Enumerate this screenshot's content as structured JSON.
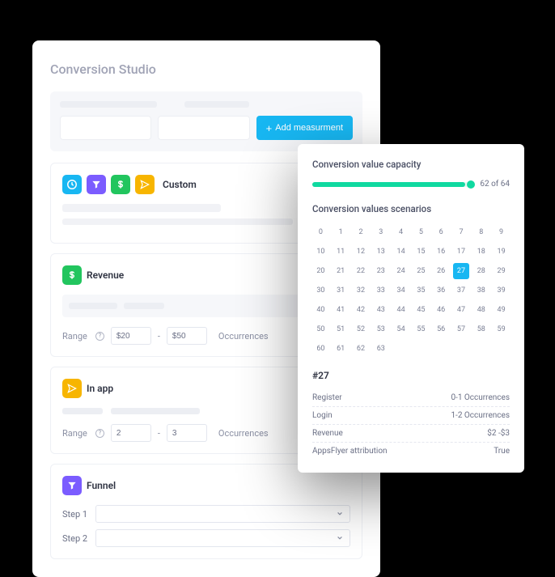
{
  "header": {
    "title": "Conversion Studio"
  },
  "toolbar": {
    "add_label": "Add measurment"
  },
  "sections": {
    "custom": {
      "label": "Custom"
    },
    "revenue": {
      "label": "Revenue",
      "range_label": "Range",
      "from": "$20",
      "to": "$50",
      "occurrences_label": "Occurrences"
    },
    "inapp": {
      "label": "In app",
      "range_label": "Range",
      "from": "2",
      "to": "3",
      "occurrences_label": "Occurrences"
    },
    "funnel": {
      "label": "Funnel",
      "step1_label": "Step 1",
      "step2_label": "Step 2"
    }
  },
  "side": {
    "capacity_title": "Conversion value capacity",
    "capacity_text": "62 of 64",
    "scenarios_title": "Conversion values scenarios",
    "cells": [
      "0",
      "1",
      "2",
      "3",
      "4",
      "5",
      "6",
      "7",
      "8",
      "9",
      "10",
      "11",
      "12",
      "13",
      "14",
      "15",
      "16",
      "17",
      "18",
      "19",
      "20",
      "21",
      "22",
      "23",
      "24",
      "25",
      "26",
      "27",
      "28",
      "29",
      "30",
      "31",
      "32",
      "33",
      "34",
      "35",
      "36",
      "37",
      "38",
      "39",
      "40",
      "41",
      "42",
      "43",
      "44",
      "45",
      "46",
      "47",
      "48",
      "49",
      "50",
      "51",
      "52",
      "53",
      "54",
      "55",
      "56",
      "57",
      "58",
      "59",
      "60",
      "61",
      "62",
      "63"
    ],
    "selected": "27",
    "detail_title": "#27",
    "details": [
      {
        "k": "Register",
        "v": "0-1 Occurrences"
      },
      {
        "k": "Login",
        "v": "1-2 Occurrences"
      },
      {
        "k": "Revenue",
        "v": "$2 -$3"
      },
      {
        "k": "AppsFlyer attribution",
        "v": "True"
      }
    ]
  }
}
